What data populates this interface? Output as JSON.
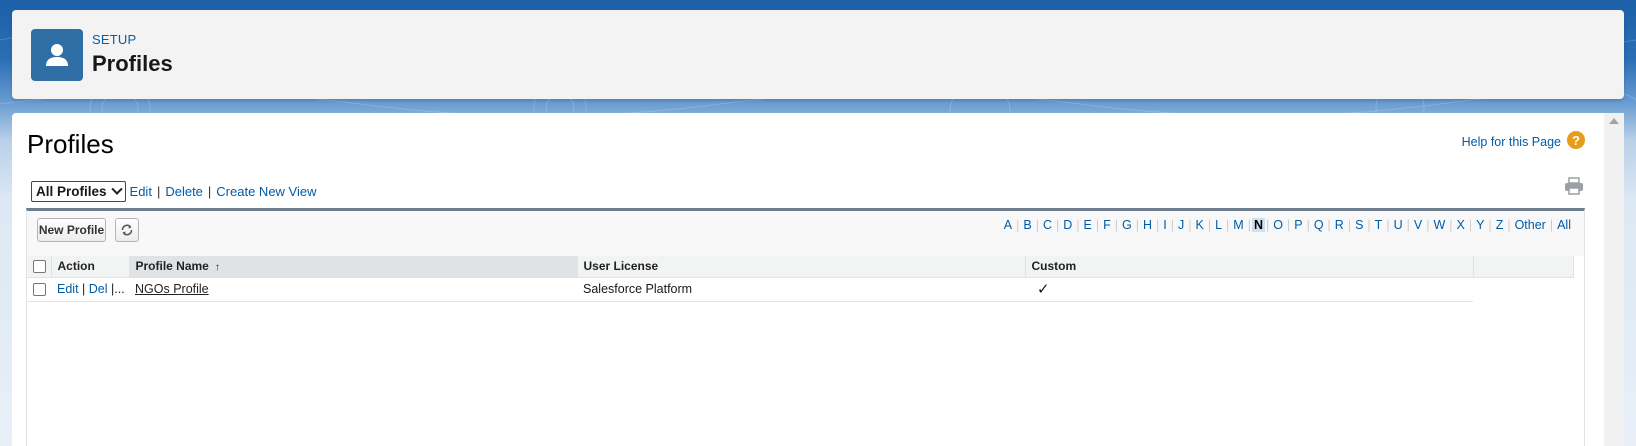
{
  "header": {
    "eyebrow": "SETUP",
    "title": "Profiles",
    "icon": "person-icon"
  },
  "page": {
    "title": "Profiles",
    "help_label": "Help for this Page",
    "help_icon": "?"
  },
  "view_bar": {
    "selected_view": "All Profiles",
    "edit_label": "Edit",
    "delete_label": "Delete",
    "create_label": "Create New View",
    "separator": "|"
  },
  "list": {
    "new_button": "New Profile",
    "alphabet": [
      "A",
      "B",
      "C",
      "D",
      "E",
      "F",
      "G",
      "H",
      "I",
      "J",
      "K",
      "L",
      "M",
      "N",
      "O",
      "P",
      "Q",
      "R",
      "S",
      "T",
      "U",
      "V",
      "W",
      "X",
      "Y",
      "Z",
      "Other",
      "All"
    ],
    "active_letter": "N",
    "columns": {
      "action": "Action",
      "name": "Profile Name",
      "sort_indicator": "↑",
      "license": "User License",
      "custom": "Custom"
    },
    "rows": [
      {
        "edit": "Edit",
        "sep1": "|",
        "del": "Del",
        "sep2": "|",
        "more": "...",
        "name": "NGOs Profile",
        "license": "Salesforce Platform",
        "custom": "✓"
      }
    ]
  },
  "colors": {
    "accent": "#015ba7",
    "header_icon_bg": "#2f6fa5",
    "help_icon_bg": "#e69d1c"
  }
}
